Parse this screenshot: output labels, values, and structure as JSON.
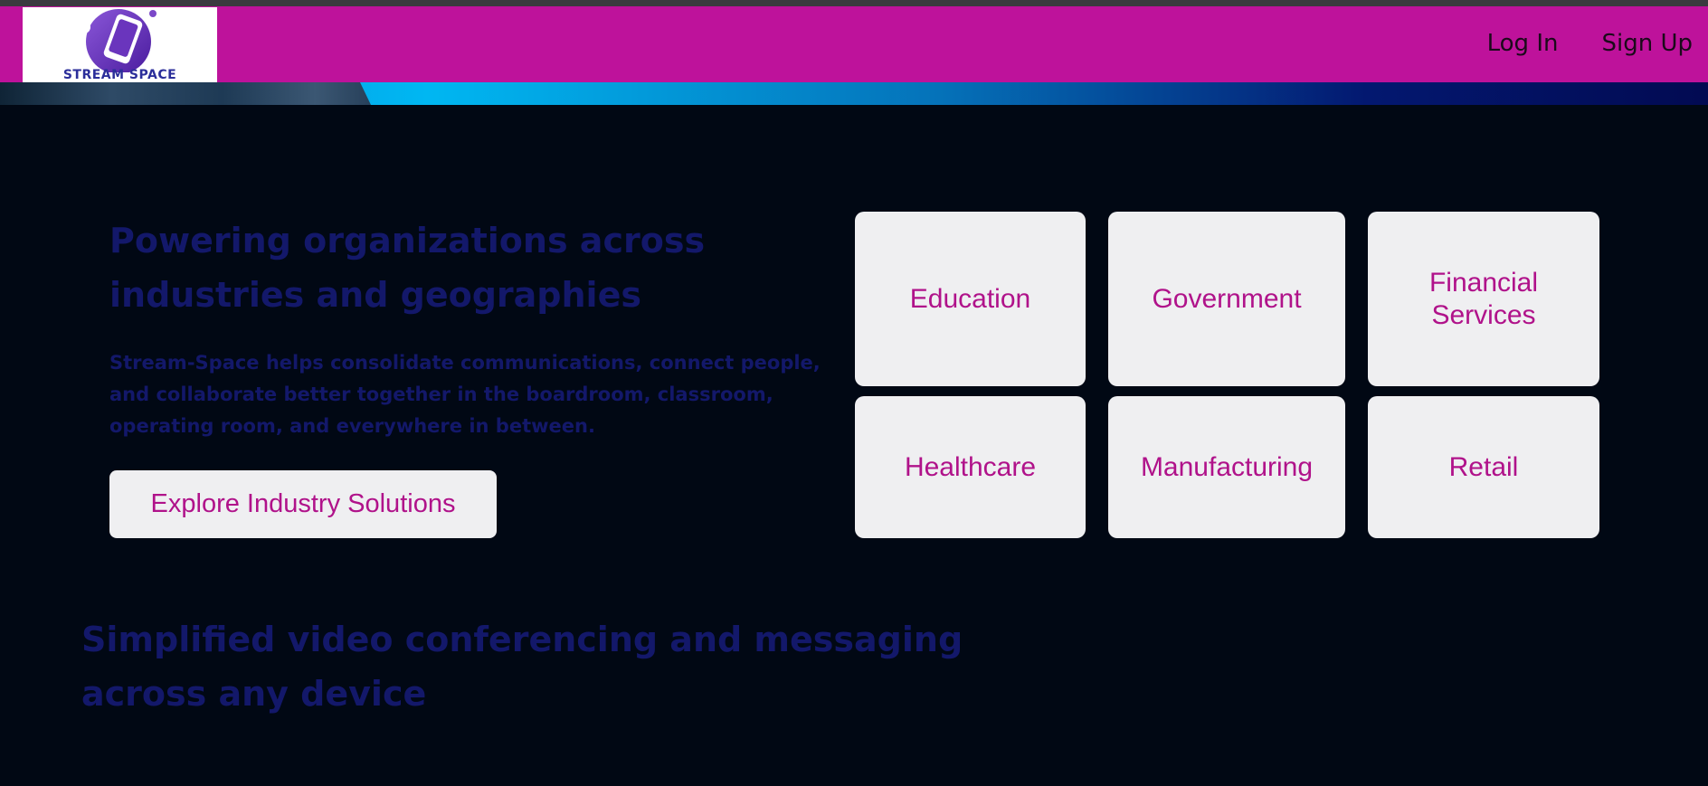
{
  "colors": {
    "navbar": "#be129b",
    "page_background": "#010814",
    "heading_text": "#13186a",
    "accent_text": "#b0128a",
    "tile_background": "#efeff1"
  },
  "header": {
    "logo_text": "STREAM SPACE",
    "logo_icon": "tablet-planet-icon",
    "nav": {
      "login_label": "Log In",
      "signup_label": "Sign Up"
    }
  },
  "hero": {
    "title": "Powering organizations across industries and geographies",
    "description": "Stream-Space helps consolidate communications, connect people, and collaborate better together in the boardroom, classroom, operating room, and everywhere in between.",
    "cta_label": "Explore Industry Solutions"
  },
  "industries": [
    {
      "label": "Education"
    },
    {
      "label": "Government"
    },
    {
      "label": "Financial Services"
    },
    {
      "label": "Healthcare"
    },
    {
      "label": "Manufacturing"
    },
    {
      "label": "Retail"
    }
  ],
  "section2": {
    "title": "Simplified video conferencing and messaging across any device"
  }
}
